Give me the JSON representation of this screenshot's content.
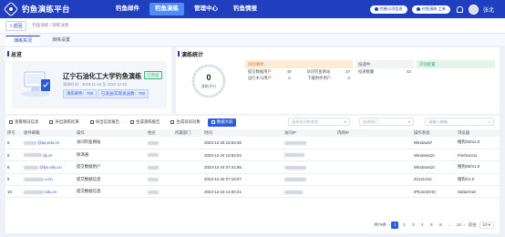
{
  "app": {
    "title": "钓鱼演练平台"
  },
  "nav": [
    {
      "label": "钓鱼邮件",
      "active": false
    },
    {
      "label": "钓鱼演练",
      "active": true
    },
    {
      "label": "管理中心",
      "active": false
    },
    {
      "label": "钓鱼情报",
      "active": false
    }
  ],
  "header": {
    "pill1": "完善公司信息",
    "pill2": "钓鱼演练 工单",
    "username": "张北"
  },
  "breadcrumb": {
    "back": "返回",
    "path": "钓鱼演练 / 演练详情"
  },
  "tabs": [
    {
      "label": "演练实况"
    },
    {
      "label": "演练设置"
    }
  ],
  "overview": {
    "title": "总览",
    "name": "辽宁石油化工大学钓鱼演练",
    "status": "已完成",
    "time": "演练时间：2023-11-15 至 2023-12-25",
    "tag_count": "演练邮件：790",
    "tag_target": "已发送/实际发送数：790"
  },
  "stats": {
    "title": "演练统计",
    "gauge_value": "0",
    "gauge_label": "演练评分",
    "risk": {
      "head": "风险事件",
      "rows": [
        {
          "k": "提交数据用户",
          "v1": "49",
          "k2": "访问钓鱼网站",
          "v2": "27"
        },
        {
          "k": "运行木马用户",
          "v1": "0",
          "k2": "下载附件用户",
          "v2": "0"
        },
        {
          "k": "",
          "v1": "",
          "k2": "",
          "v2": ""
        }
      ]
    },
    "visit": {
      "head": "投递中",
      "rows": [
        {
          "k": "投递数量",
          "v": "52"
        }
      ]
    },
    "report": {
      "head": "识别处置",
      "rows": []
    }
  },
  "toolbar": {
    "btn1": "查看情况信息",
    "btn2": "导出演练结果",
    "btn3": "导出信息报告",
    "btn4": "生成演练报告",
    "btn5": "生成培训对象",
    "btn6": "数据大屏",
    "sel1": "选择访问的状态",
    "sel2": "选择部门",
    "sel3": "请输入邮箱"
  },
  "table": {
    "headers": [
      "序号",
      "收件邮箱",
      "操作",
      "姓名",
      "所属部门",
      "时间",
      "访问IP",
      "内网IP",
      "操作系统",
      "浏览器"
    ],
    "rows": [
      {
        "no": "5",
        "email": "@qq.edu.cn",
        "action": "访问钓鱼网站",
        "name": "",
        "dept": "",
        "time": "2023-12-26 15:53:48",
        "ip": "",
        "lan": "",
        "os": "Windows7",
        "browser": "搜狗SE/v1.0"
      },
      {
        "no": "6",
        "email": "dy.cn",
        "action": "拟演通",
        "name": "",
        "dept": "",
        "time": "2023-12-24 15:53:04",
        "ip": "",
        "lan": "",
        "os": "Windows10",
        "browser": "Firefox/v11"
      },
      {
        "no": "8",
        "email": "@lyu.edu.cn",
        "action": "提交数据用户",
        "name": "",
        "dept": "",
        "time": "2023-12-24 07:41:56",
        "ip": "",
        "lan": "",
        "os": "Windows10",
        "browser": "搜狗SE/v1.0"
      },
      {
        "no": "9",
        "email": "u.cn",
        "action": "提交数据信息",
        "name": "",
        "dept": "",
        "time": "2023-12-24 07:19:07",
        "ip": "",
        "lan": "",
        "os": "Z112123A",
        "browser": "搜狗/v1.0"
      },
      {
        "no": "10",
        "email": "edu.cn",
        "action": "提交数据信息",
        "name": "",
        "dept": "",
        "time": "2023-12-23 14:00:21",
        "ip": "",
        "lan": "",
        "os": "iPhone(iOS)",
        "browser": "Safari/v18"
      }
    ]
  },
  "pager": {
    "total": "共79条",
    "pages": [
      "1",
      "2",
      "3",
      "4",
      "5",
      "6",
      "...",
      "10"
    ],
    "size": "10",
    "go_label": "前往"
  }
}
